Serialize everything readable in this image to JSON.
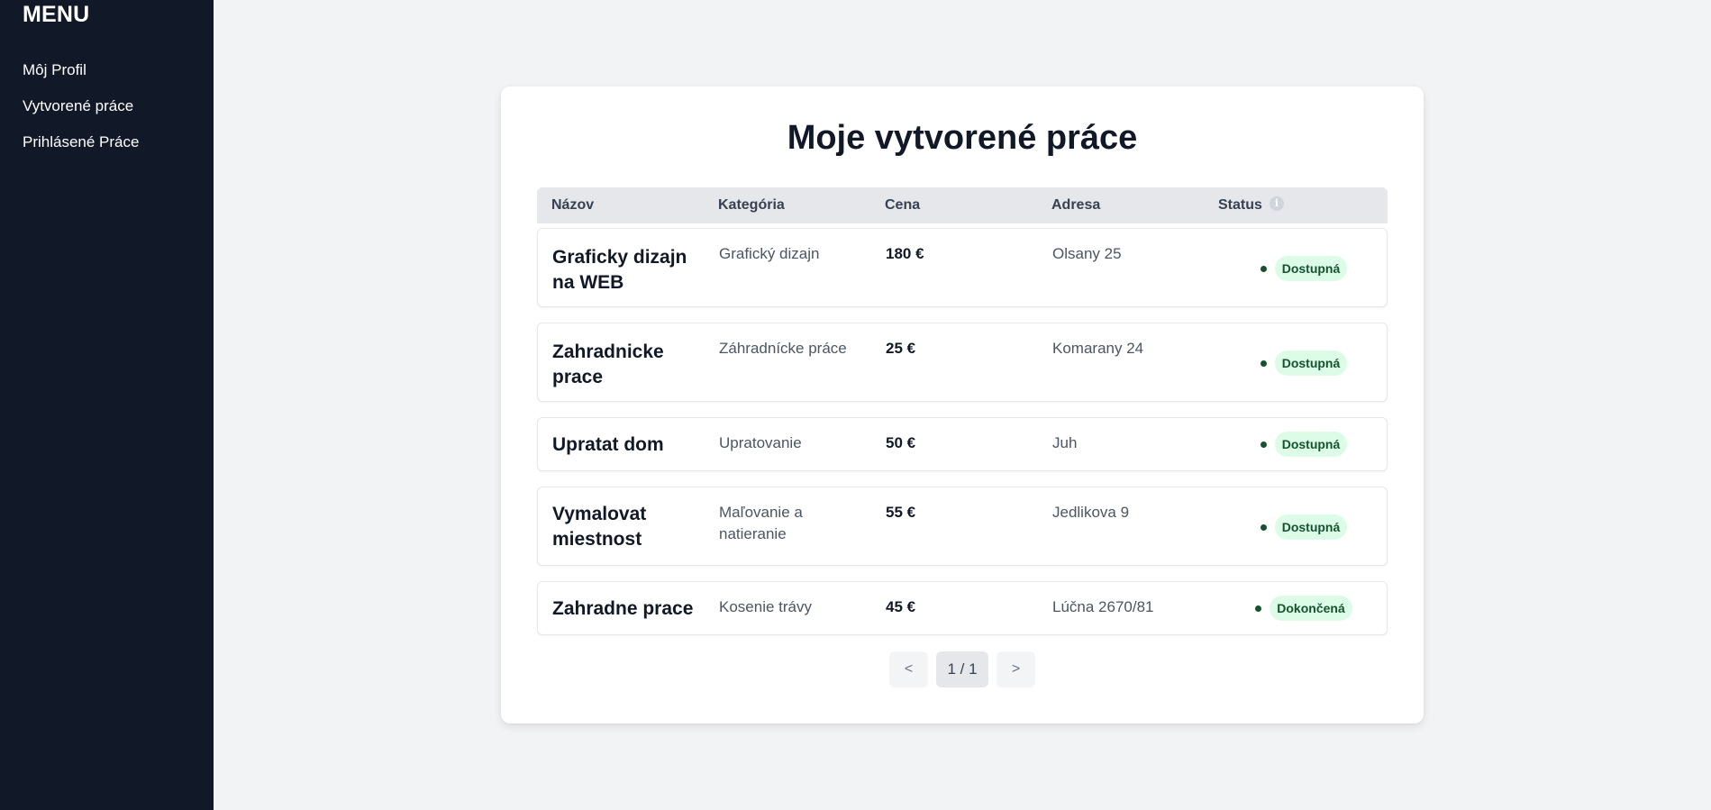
{
  "sidebar": {
    "title": "MENU",
    "items": [
      {
        "label": "Môj Profil"
      },
      {
        "label": "Vytvorené práce"
      },
      {
        "label": "Prihlásené Práce"
      }
    ]
  },
  "main": {
    "title": "Moje vytvorené práce",
    "columns": [
      "Názov",
      "Kategória",
      "Cena",
      "Adresa",
      "Status"
    ],
    "status_info_icon": "info-icon",
    "rows": [
      {
        "name": "Graficky dizajn na WEB",
        "category": "Grafický dizajn",
        "price": "180 €",
        "address": "Olsany 25",
        "status": "Dostupná"
      },
      {
        "name": "Zahradnicke prace",
        "category": "Záhradnícke práce",
        "price": "25 €",
        "address": "Komarany 24",
        "status": "Dostupná"
      },
      {
        "name": "Upratat dom",
        "category": "Upratovanie",
        "price": "50 €",
        "address": "Juh",
        "status": "Dostupná"
      },
      {
        "name": "Vymalovat miestnost",
        "category": "Maľovanie a natieranie",
        "price": "55 €",
        "address": "Jedlikova 9",
        "status": "Dostupná"
      },
      {
        "name": "Zahradne prace",
        "category": "Kosenie trávy",
        "price": "45 €",
        "address": "Lúčna 2670/81",
        "status": "Dokončená"
      }
    ],
    "pagination": {
      "prev": "<",
      "current": "1 / 1",
      "next": ">"
    }
  },
  "colors": {
    "sidebar_bg": "#111827",
    "page_bg": "#f2f3f5",
    "badge_bg": "#dcfce7",
    "badge_text": "#14532d"
  }
}
